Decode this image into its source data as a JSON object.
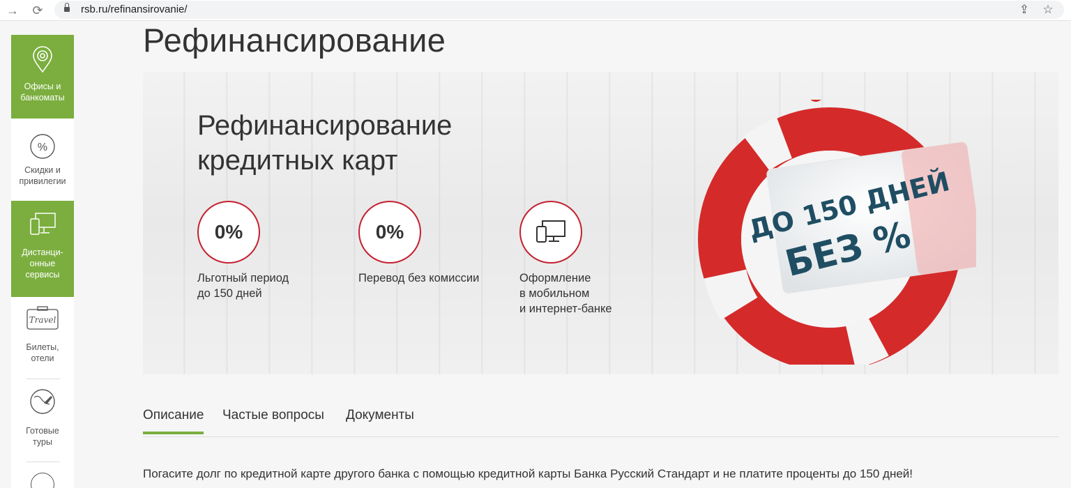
{
  "browser": {
    "url": "rsb.ru/refinansirovanie/",
    "back_icon": "arrow-right-icon",
    "reload_icon": "reload-icon"
  },
  "sidebar": {
    "items": [
      {
        "label": "Офисы и\nбанкоматы",
        "icon": "location-pin-icon",
        "active": true
      },
      {
        "label": "Скидки и\nпривилегии",
        "icon": "percent-icon",
        "active": false
      },
      {
        "label": "Дистанци-\nонные\nсервисы",
        "icon": "devices-icon",
        "active": true
      },
      {
        "label": "Билеты,\nотели",
        "icon": "travel-suitcase-icon",
        "active": false
      },
      {
        "label": "Готовые\nтуры",
        "icon": "globe-plane-icon",
        "active": false
      }
    ]
  },
  "page": {
    "title": "Рефинансирование"
  },
  "banner": {
    "title_line1": "Рефинансирование",
    "title_line2": "кредитных карт",
    "features": [
      {
        "circle": "0%",
        "text": "Льготный период\nдо 150 дней"
      },
      {
        "circle": "0%",
        "text": "Перевод без комиссии"
      },
      {
        "circle": "",
        "icon": "devices-icon",
        "text": "Оформление\nв мобильном\nи интернет-банке"
      }
    ],
    "promo_line1": "ДО 150 ДНЕЙ",
    "promo_line2": "БЕЗ %",
    "colors": {
      "accent_red": "#c4202f",
      "promo_text": "#1f4e63"
    }
  },
  "tabs": [
    {
      "label": "Описание",
      "active": true
    },
    {
      "label": "Частые вопросы",
      "active": false
    },
    {
      "label": "Документы",
      "active": false
    }
  ],
  "description": "Погасите долг по кредитной карте другого банка с помощью кредитной карты Банка Русский Стандарт и не платите проценты до 150 дней!",
  "colors": {
    "brand_green": "#7bae3e"
  }
}
